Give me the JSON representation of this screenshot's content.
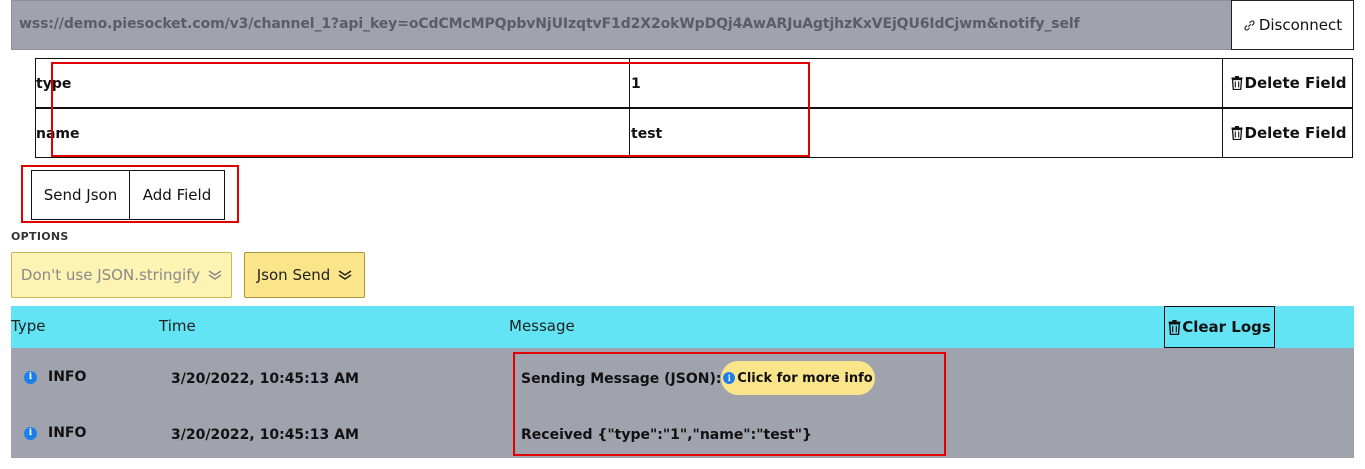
{
  "connection": {
    "url": "wss://demo.piesocket.com/v3/channel_1?api_key=oCdCMcMPQpbvNjUIzqtvF1d2X2okWpDQj4AwARJuAgtjhzKxVEjQU6IdCjwm&notify_self",
    "disconnect_label": "Disconnect"
  },
  "fields": [
    {
      "key": "type",
      "value": "1",
      "delete_label": "Delete Field"
    },
    {
      "key": "name",
      "value": "test",
      "delete_label": "Delete Field"
    }
  ],
  "actions": {
    "send_json_label": "Send Json",
    "add_field_label": "Add Field"
  },
  "options": {
    "label": "OPTIONS",
    "stringify_select": "Don't use JSON.stringify",
    "send_mode_select": "Json Send"
  },
  "logs": {
    "headers": {
      "type": "Type",
      "time": "Time",
      "message": "Message"
    },
    "clear_label": "Clear Logs",
    "rows": [
      {
        "type": "INFO",
        "time": "3/20/2022, 10:45:13 AM",
        "message": "Sending Message (JSON):",
        "more_info_label": "Click for more info"
      },
      {
        "type": "INFO",
        "time": "3/20/2022, 10:45:13 AM",
        "message": "Received {\"type\":\"1\",\"name\":\"test\"}"
      }
    ]
  },
  "colors": {
    "url_bar": "#a0a3ad",
    "log_header": "#62e4f5",
    "log_body": "#a0a3ad",
    "select_faded": "#fdf3b3",
    "select_active": "#fbe58b",
    "highlight_box": "#e00000",
    "info_icon": "#1e7ee8"
  }
}
